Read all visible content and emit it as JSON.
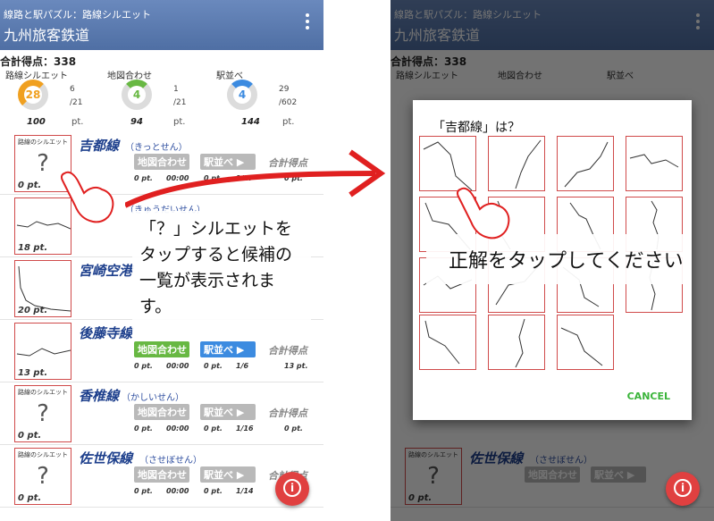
{
  "app": {
    "subtitle": "線路と駅パズル：路線シルエット",
    "title": "九州旅客鉄道"
  },
  "summary": {
    "total_label": "合計得点：338",
    "stats": [
      {
        "label": "路線シルエット",
        "value": "28",
        "frac_top": "6",
        "frac_bottom": "/21",
        "points": "100",
        "unit": "pt.",
        "color": "#f0a020",
        "progress": 0.29
      },
      {
        "label": "地図合わせ",
        "value": "4",
        "frac_top": "1",
        "frac_bottom": "/21",
        "points": "94",
        "unit": "pt.",
        "color": "#68b843",
        "progress": 0.05
      },
      {
        "label": "駅並べ",
        "value": "4",
        "frac_top": "29",
        "frac_bottom": "/602",
        "points": "144",
        "unit": "pt.",
        "color": "#3c8be0",
        "progress": 0.05
      }
    ]
  },
  "rows": [
    {
      "name": "吉都線",
      "kana": "（きっとせん）",
      "thumb_label": "路線のシルエット",
      "thumb_q": "?",
      "thumb_pts": "0 pt.",
      "map": "地図合わせ ▶",
      "arrange": "駅並べ ▶",
      "total": "合計得点",
      "s1": "0 pt.",
      "s2": "00:00",
      "s3": "0 pt.",
      "s4": "1/17",
      "s5": "0 pt."
    },
    {
      "name": "",
      "kana": "（きゅうだいせん）",
      "thumb_pts": "18 pt."
    },
    {
      "name": "宮崎空港",
      "kana": "",
      "thumb_pts": "20 pt."
    },
    {
      "name": "後藤寺線",
      "kana": "",
      "thumb_pts": "13 pt.",
      "map": "地図合わせ ▶",
      "arrange": "駅並べ ▶",
      "total": "合計得点",
      "s1": "0 pt.",
      "s2": "00:00",
      "s3": "0 pt.",
      "s4": "1/6",
      "s5": "13 pt."
    },
    {
      "name": "香椎線",
      "kana": "（かしいせん）",
      "thumb_label": "路線のシルエット",
      "thumb_q": "?",
      "thumb_pts": "0 pt.",
      "map": "地図合わせ ▶",
      "arrange": "駅並べ ▶",
      "total": "合計得点",
      "s1": "0 pt.",
      "s2": "00:00",
      "s3": "0 pt.",
      "s4": "1/16",
      "s5": "0 pt."
    },
    {
      "name": "佐世保線",
      "kana": "（させぼせん）",
      "thumb_label": "路線のシルエット",
      "thumb_q": "?",
      "thumb_pts": "0 pt.",
      "map": "地図合わせ ▶",
      "arrange": "駅並べ ▶",
      "total": "合計得点",
      "s1": "0 pt.",
      "s2": "00:00",
      "s3": "0 pt.",
      "s4": "1/14"
    }
  ],
  "callout": "「？」シルエットをタップすると候補の一覧が表示されます。",
  "dialog": {
    "title": "「吉都線」は？",
    "cancel": "CANCEL"
  },
  "banner": "正解をタップしてください",
  "fab_icon": "info-icon",
  "colors": {
    "appbar": "#5b7bb0",
    "accent_red": "#e02020"
  }
}
